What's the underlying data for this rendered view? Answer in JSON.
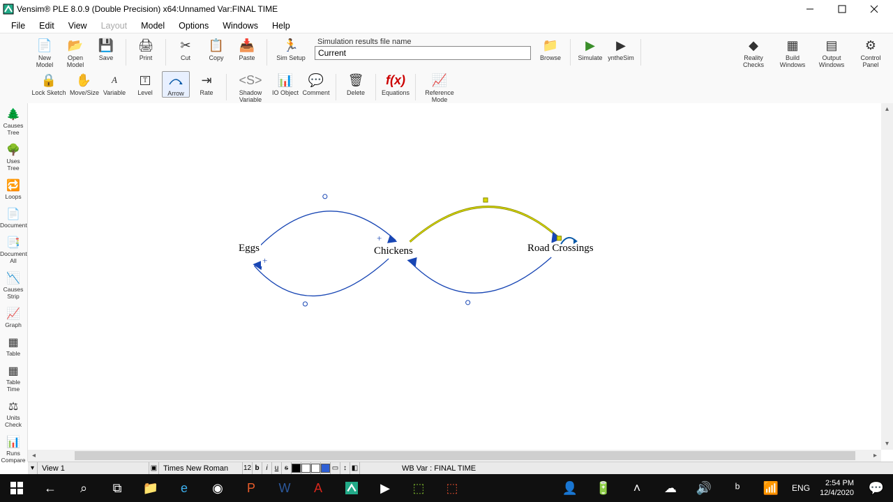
{
  "window": {
    "title": "Vensim® PLE 8.0.9 (Double Precision) x64:Unnamed Var:FINAL TIME"
  },
  "menu": {
    "file": "File",
    "edit": "Edit",
    "view": "View",
    "layout": "Layout",
    "model": "Model",
    "options": "Options",
    "windows": "Windows",
    "help": "Help"
  },
  "toolbar1": {
    "new_model": "New Model",
    "open_model": "Open Model",
    "save": "Save",
    "print": "Print",
    "cut": "Cut",
    "copy": "Copy",
    "paste": "Paste",
    "sim_setup": "Sim Setup",
    "sim_file_label": "Simulation results file name",
    "sim_file_value": "Current",
    "browse": "Browse",
    "simulate": "Simulate",
    "synthesim": "yntheSim",
    "reality_checks": "Reality Checks",
    "build_windows": "Build Windows",
    "output_windows": "Output Windows",
    "control_panel": "Control Panel"
  },
  "toolbar2": {
    "lock_sketch": "Lock Sketch",
    "move_size": "Move/Size",
    "variable": "Variable",
    "level": "Level",
    "arrow": "Arrow",
    "rate": "Rate",
    "shadow_variable": "Shadow Variable",
    "io_object": "IO Object",
    "comment": "Comment",
    "delete": "Delete",
    "equations": "Equations",
    "reference_mode": "Reference Mode"
  },
  "left_tools": {
    "causes_tree": "Causes Tree",
    "uses_tree": "Uses Tree",
    "loops": "Loops",
    "document": "Document",
    "document_all": "Document All",
    "causes_strip": "Causes Strip",
    "graph": "Graph",
    "table": "Table",
    "table_time": "Table Time",
    "units_check": "Units Check",
    "runs_compare": "Runs Compare"
  },
  "diagram": {
    "eggs": "Eggs",
    "chickens": "Chickens",
    "road_crossings": "Road Crossings",
    "plus1": "+",
    "plus2": "+"
  },
  "status": {
    "view": "View 1",
    "font": "Times New Roman",
    "font_size": "12",
    "wb": "WB Var : FINAL TIME"
  },
  "taskbar": {
    "lang": "ENG",
    "time": "2:54 PM",
    "date": "12/4/2020"
  }
}
